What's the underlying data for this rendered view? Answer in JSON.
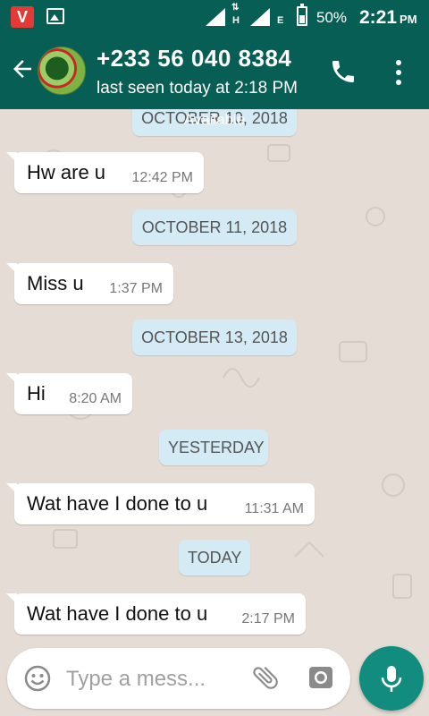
{
  "status_bar": {
    "battery": "50%",
    "time": "2:21",
    "ampm": "PM",
    "network_1": "H",
    "network_2": "E",
    "app_icon_letter": "V"
  },
  "header": {
    "contact_name": "+233 56 040 8384",
    "last_seen": "last seen today at 2:18 PM"
  },
  "chat": {
    "floating_status": "Available",
    "items": [
      {
        "kind": "date",
        "text": "OCTOBER 10, 2018"
      },
      {
        "kind": "incoming",
        "text": "Hw are u",
        "time": "12:42 PM"
      },
      {
        "kind": "date",
        "text": "OCTOBER 11, 2018"
      },
      {
        "kind": "incoming",
        "text": "Miss u",
        "time": "1:37 PM"
      },
      {
        "kind": "date",
        "text": "OCTOBER 13, 2018"
      },
      {
        "kind": "incoming",
        "text": "Hi",
        "time": "8:20 AM"
      },
      {
        "kind": "date",
        "text": "YESTERDAY"
      },
      {
        "kind": "incoming",
        "text": "Wat have I done to u",
        "time": "11:31 AM"
      },
      {
        "kind": "date",
        "text": "TODAY"
      },
      {
        "kind": "incoming",
        "text": "Wat have I done to u",
        "time": "2:17 PM"
      }
    ]
  },
  "composer": {
    "placeholder": "Type a mess..."
  },
  "colors": {
    "header": "#075e54",
    "chat_background": "#e5ddd5",
    "date_chip": "#d4eaf4",
    "mic_button": "#128c7e"
  },
  "icons": [
    "back-arrow-icon",
    "phone-icon",
    "more-vert-icon",
    "emoji-icon",
    "attach-icon",
    "camera-icon",
    "mic-icon"
  ]
}
